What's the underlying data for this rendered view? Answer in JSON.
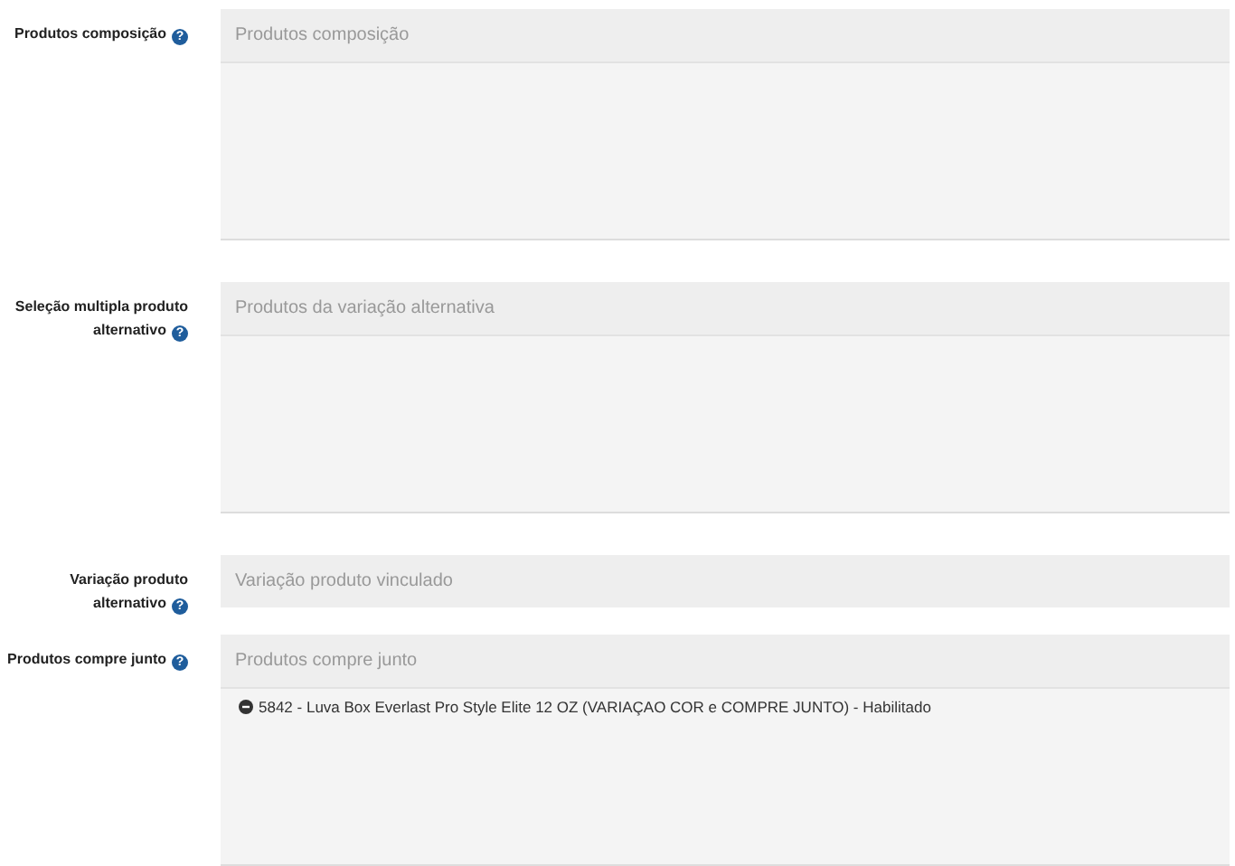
{
  "fields": [
    {
      "kind": "multi",
      "label_lines": [
        "Produtos composição"
      ],
      "help": "?",
      "placeholder": "Produtos composição"
    },
    {
      "kind": "multi",
      "label_lines": [
        "Seleção multipla produto",
        "alternativo"
      ],
      "help": "?",
      "placeholder": "Produtos da variação alternativa"
    },
    {
      "kind": "single",
      "label_lines": [
        "Variação produto",
        "alternativo"
      ],
      "help": "?",
      "placeholder": "Variação produto vinculado"
    },
    {
      "kind": "multi",
      "label_lines": [
        "Produtos compre junto"
      ],
      "help": "?",
      "placeholder": "Produtos compre junto",
      "items": [
        {
          "text": "5842 - Luva Box Everlast Pro Style Elite 12 OZ (VARIAÇAO COR e COMPRE JUNTO) - Habilitado"
        }
      ]
    }
  ]
}
